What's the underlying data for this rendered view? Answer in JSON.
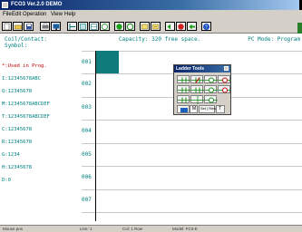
{
  "window": {
    "title": "FCO3 Ver.2.0 DEMO"
  },
  "menu": [
    "File",
    "Edit",
    "Operation",
    "View",
    "Help"
  ],
  "toolbar": {
    "icons": [
      "new-file-icon",
      "open-folder-icon",
      "save-icon",
      "print-icon",
      "monitor-icon",
      "ladder-icon",
      "grid-icon",
      "table-icon",
      "coil-icon",
      "compile-icon",
      "run-icon",
      "stop-icon",
      "transfer-icon",
      "upload-icon",
      "download-icon",
      "help-icon"
    ]
  },
  "header": {
    "coil_label": "Coil/Contact:",
    "symbol_label": "Symbol:",
    "capacity": "Capacity: 320 free space.",
    "mode": "PC Mode: Program"
  },
  "monitor": [
    {
      "text": "*:Used in Prog.",
      "color": "#c00000"
    },
    {
      "text": "I:12345678ABC",
      "color": "#008080"
    },
    {
      "text": "Q:12345678",
      "color": "#008080"
    },
    {
      "text": "M:12345678ABCDEF",
      "color": "#008080"
    },
    {
      "text": "T:12345678ABCDEF",
      "color": "#008080"
    },
    {
      "text": "C:12345678",
      "color": "#008080"
    },
    {
      "text": "R:12345678",
      "color": "#008080"
    },
    {
      "text": "G:1234",
      "color": "#008080"
    },
    {
      "text": "H:12345678",
      "color": "#008080"
    },
    {
      "text": "D:0",
      "color": "#008080"
    }
  ],
  "rungs": [
    "001",
    "002",
    "003",
    "004",
    "005",
    "006",
    "007"
  ],
  "ladder_tools": {
    "title": "Ladder Tools",
    "row4_labels": [
      "",
      "M",
      "Set | Reset",
      "T"
    ]
  },
  "statusbar": {
    "left": "Mouse pos",
    "middle": "Line: 1",
    "right1": "Col: 1 Row",
    "right2": "Model: FC3-E"
  },
  "colors": {
    "accent": "#008080",
    "cursor": "#0f7b7b",
    "used": "#c00000"
  }
}
